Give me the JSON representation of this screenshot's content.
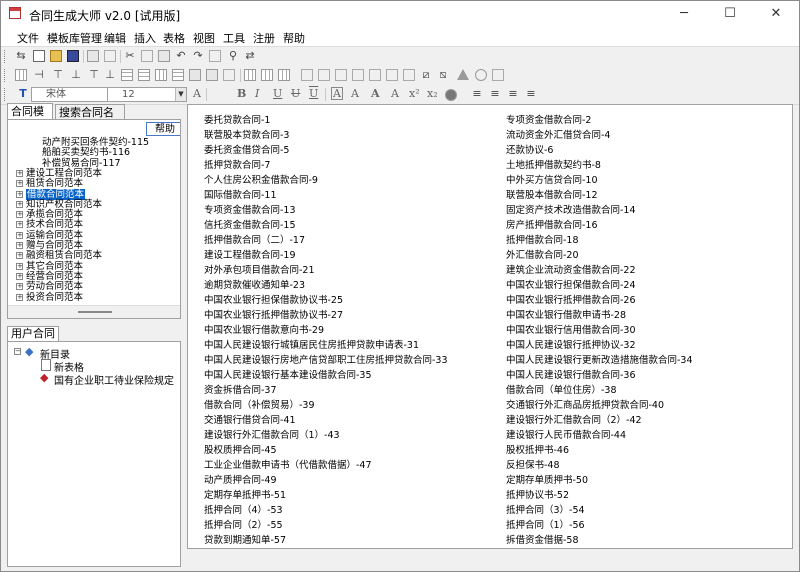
{
  "window": {
    "title": "合同生成大师 v2.0 [试用版]",
    "controls": [
      "─",
      "☐",
      "✕"
    ]
  },
  "menu": [
    "文件",
    "模板库管理",
    "编辑",
    "插入",
    "表格",
    "视图",
    "工具",
    "注册",
    "帮助"
  ],
  "format_toolbar": {
    "font_name": "宋体",
    "font_size": "12"
  },
  "left_tabs": [
    "合同模板",
    "搜索合同名称"
  ],
  "help_button": "帮助",
  "tree_items": [
    {
      "label": "动产附买回条件契约-115",
      "level": 2
    },
    {
      "label": "船舶买卖契约书-116",
      "level": 2
    },
    {
      "label": "补偿贸易合同-117",
      "level": 2
    },
    {
      "label": "建设工程合同范本",
      "level": 1
    },
    {
      "label": "租赁合同范本",
      "level": 1
    },
    {
      "label": "借款合同范本",
      "level": 1,
      "selected": true
    },
    {
      "label": "知识产权合同范本",
      "level": 1
    },
    {
      "label": "承揽合同范本",
      "level": 1
    },
    {
      "label": "技术合同范本",
      "level": 1
    },
    {
      "label": "运输合同范本",
      "level": 1
    },
    {
      "label": "赠与合同范本",
      "level": 1
    },
    {
      "label": "融资租赁合同范本",
      "level": 1
    },
    {
      "label": "其它合同范本",
      "level": 1
    },
    {
      "label": "经营合同范本",
      "level": 1
    },
    {
      "label": "劳动合同范本",
      "level": 1
    },
    {
      "label": "投资合同范本",
      "level": 1
    }
  ],
  "user_tab": "用户合同",
  "user_tree": [
    {
      "label": "新目录",
      "level": 0
    },
    {
      "label": "新表格",
      "level": 1
    },
    {
      "label": "国有企业职工待业保险规定",
      "level": 1
    }
  ],
  "contracts_left": [
    "委托贷款合同-1",
    "联营股本贷款合同-3",
    "委托资金借贷合同-5",
    "抵押贷款合同-7",
    "个人住房公积金借款合同-9",
    "国际借款合同-11",
    "专项资金借款合同-13",
    "信托资金借款合同-15",
    "抵押借款合同（二）-17",
    "建设工程借款合同-19",
    "对外承包项目借款合同-21",
    "逾期贷款催收通知单-23",
    "中国农业银行担保借款协议书-25",
    "中国农业银行抵押借款协议书-27",
    "中国农业银行借款意向书-29",
    "中国人民建设银行城镇居民住房抵押贷款申请表-31",
    "中国人民建设银行房地产信贷部职工住房抵押贷款合同-33",
    "中国人民建设银行基本建设借款合同-35",
    "资金拆借合同-37",
    "借款合同（补偿贸易）-39",
    "交通银行借贷合同-41",
    "建设银行外汇借款合同（1）-43",
    "股权质押合同-45",
    "工业企业借款申请书（代借款借据）-47",
    "动产质押合同-49",
    "定期存单抵押书-51",
    "抵押合同（4）-53",
    "抵押合同（2）-55",
    "贷款到期通知单-57"
  ],
  "contracts_right": [
    "专项资金借款合同-2",
    "流动资金外汇借贷合同-4",
    "还款协议-6",
    "土地抵押借款契约书-8",
    "中外买方信贷合同-10",
    "联营股本借款合同-12",
    "固定资产技术改造借款合同-14",
    "房产抵押借款合同-16",
    "抵押借款合同-18",
    "外汇借款合同-20",
    "建筑企业流动资金借款合同-22",
    "中国农业银行担保借款合同-24",
    "中国农业银行抵押借款合同-26",
    "中国农业银行借款申请书-28",
    "中国农业银行信用借款合同-30",
    "中国人民建设银行抵押协议-32",
    "中国人民建设银行更新改造措施借款合同-34",
    "中国人民建设银行借款合同-36",
    "借款合同（单位住房）-38",
    "交通银行外汇商品房抵押贷款合同-40",
    "建设银行外汇借款合同（2）-42",
    "建设银行人民币借款合同-44",
    "股权抵押书-46",
    "反担保书-48",
    "定期存单质押书-50",
    "抵押协议书-52",
    "抵押合同（3）-54",
    "抵押合同（1）-56",
    "拆借资金借据-58"
  ]
}
